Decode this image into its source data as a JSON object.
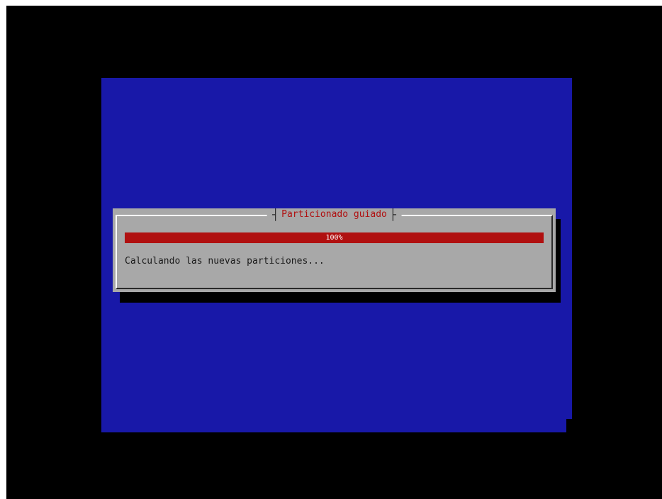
{
  "installer": {
    "dialog": {
      "title": "Particionado guiado",
      "progress": {
        "percent": 100,
        "label": "100%"
      },
      "status": "Calculando las nuevas particiones..."
    }
  },
  "colors": {
    "background": "#000000",
    "screen": "#1818a8",
    "dialog": "#a8a8a8",
    "accent": "#b01010",
    "text": "#1a1a1a"
  }
}
